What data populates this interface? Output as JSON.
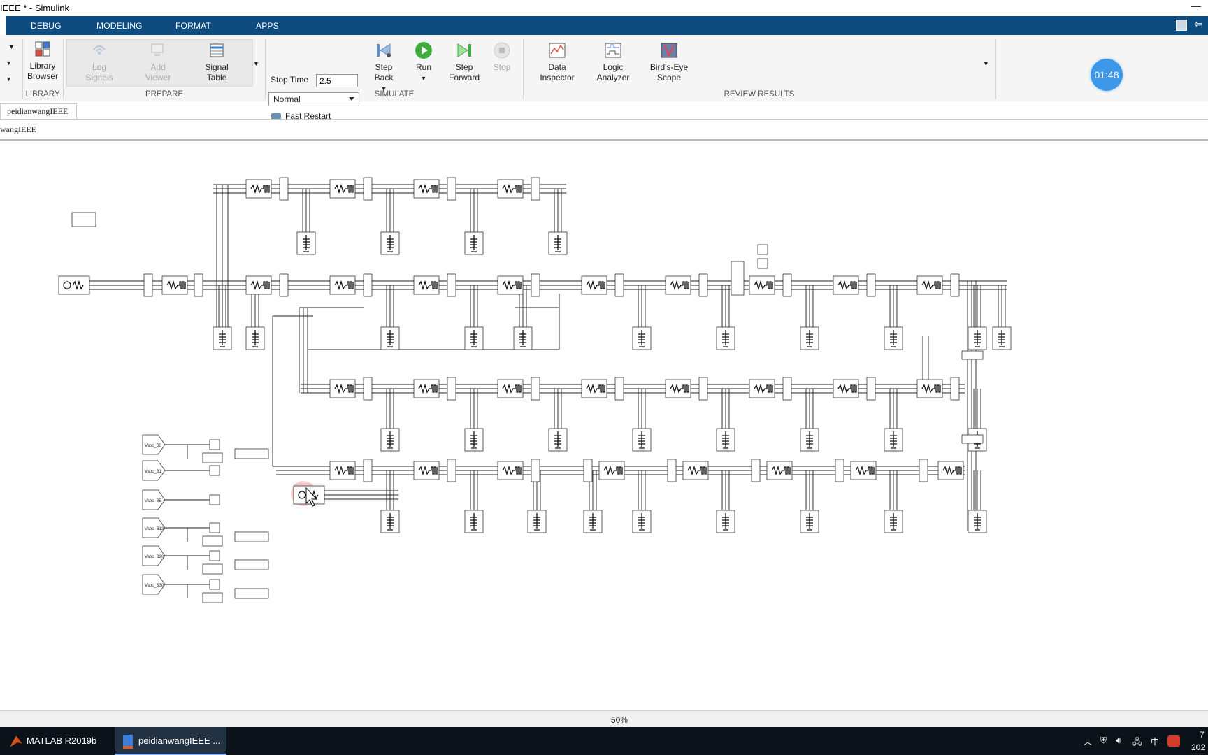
{
  "window": {
    "title": "IEEE * - Simulink"
  },
  "tabs": [
    "DEBUG",
    "MODELING",
    "FORMAT",
    "APPS"
  ],
  "ribbon": {
    "library": {
      "button": [
        "Library",
        "Browser"
      ],
      "label": "LIBRARY"
    },
    "prepare": {
      "log_signals": [
        "Log",
        "Signals"
      ],
      "add_viewer": [
        "Add",
        "Viewer"
      ],
      "signal_table": [
        "Signal",
        "Table"
      ],
      "label": "PREPARE"
    },
    "simulate": {
      "stop_time_label": "Stop Time",
      "stop_time_value": "2.5",
      "mode": "Normal",
      "fast_restart": "Fast Restart",
      "step_back": [
        "Step",
        "Back"
      ],
      "run": "Run",
      "step_forward": [
        "Step",
        "Forward"
      ],
      "stop": "Stop",
      "label": "SIMULATE"
    },
    "review": {
      "data_inspector": [
        "Data",
        "Inspector"
      ],
      "logic_analyzer": [
        "Logic",
        "Analyzer"
      ],
      "birds_eye": [
        "Bird's-Eye",
        "Scope"
      ],
      "label": "REVIEW RESULTS"
    }
  },
  "timer": "01:48",
  "document_tab": "peidianwangIEEE",
  "breadcrumb": "wangIEEE",
  "canvas": {
    "goto_tags": [
      "Vabc_B0",
      "Vabc_B1",
      "Vabc_B5",
      "Vabc_B13",
      "Vabc_B20",
      "Vabc_B30"
    ]
  },
  "zoom": "50%",
  "taskbar": {
    "items": [
      "MATLAB R2019b",
      "peidianwangIEEE ..."
    ],
    "tray_text": "中",
    "clock_top": "7",
    "clock_bottom": "202"
  },
  "colors": {
    "ribbon_tab_bar": "#0e4c7f",
    "run_green": "#3fae3f",
    "timer_blue": "#3d97e8",
    "taskbar": "#0b1219"
  }
}
